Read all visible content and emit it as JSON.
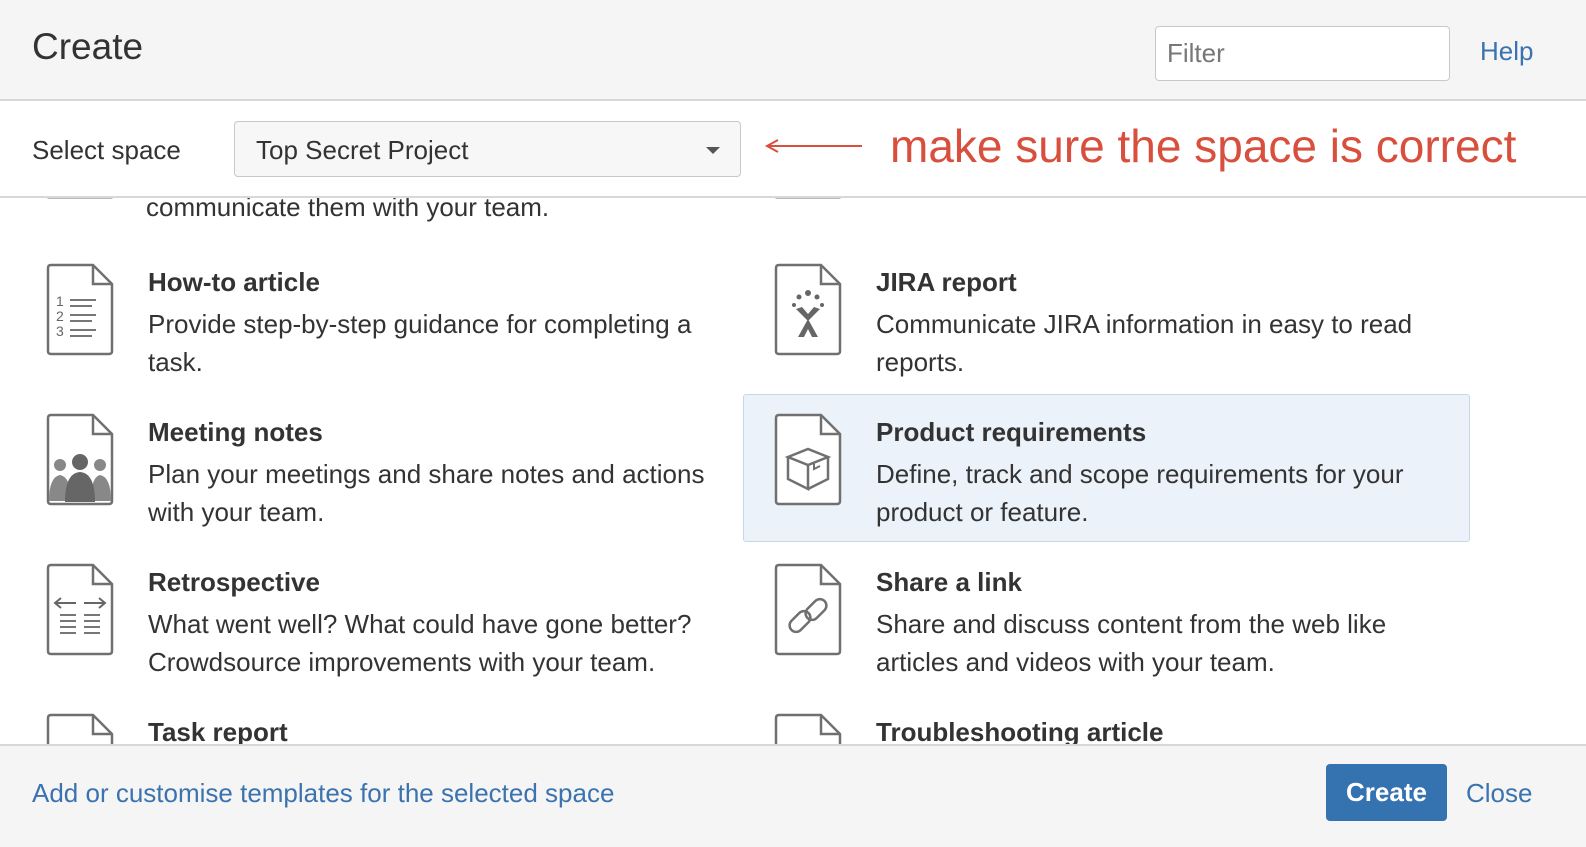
{
  "dialog": {
    "title": "Create",
    "filter_placeholder": "Filter",
    "help_label": "Help"
  },
  "space": {
    "label": "Select space",
    "selected": "Top Secret Project"
  },
  "annotation": {
    "text": "make sure the space is correct",
    "color": "#d94f3d"
  },
  "templates": {
    "partial_top_left": "communicate them with your team.",
    "items": [
      {
        "name": "How-to article",
        "description": "Provide step-by-step guidance for completing a task.",
        "icon": "numbered-list-doc-icon"
      },
      {
        "name": "JIRA report",
        "description": "Communicate JIRA information in easy to read reports.",
        "icon": "jira-doc-icon"
      },
      {
        "name": "Meeting notes",
        "description": "Plan your meetings and share notes and actions with your team.",
        "icon": "people-doc-icon"
      },
      {
        "name": "Product requirements",
        "description": "Define, track and scope requirements for your product or feature.",
        "icon": "box-doc-icon",
        "selected": true
      },
      {
        "name": "Retrospective",
        "description": "What went well? What could have gone better? Crowdsource improvements with your team.",
        "icon": "arrows-doc-icon"
      },
      {
        "name": "Share a link",
        "description": "Share and discuss content from the web like articles and videos with your team.",
        "icon": "link-doc-icon"
      },
      {
        "name": "Task report",
        "description": "",
        "icon": "doc-icon"
      },
      {
        "name": "Troubleshooting article",
        "description": "",
        "icon": "doc-icon"
      }
    ]
  },
  "footer": {
    "customise_link": "Add or customise templates for the selected space",
    "create_label": "Create",
    "close_label": "Close"
  },
  "colors": {
    "link": "#3b73af",
    "primary_button": "#3572b0",
    "selected_bg": "#ebf2f9"
  }
}
